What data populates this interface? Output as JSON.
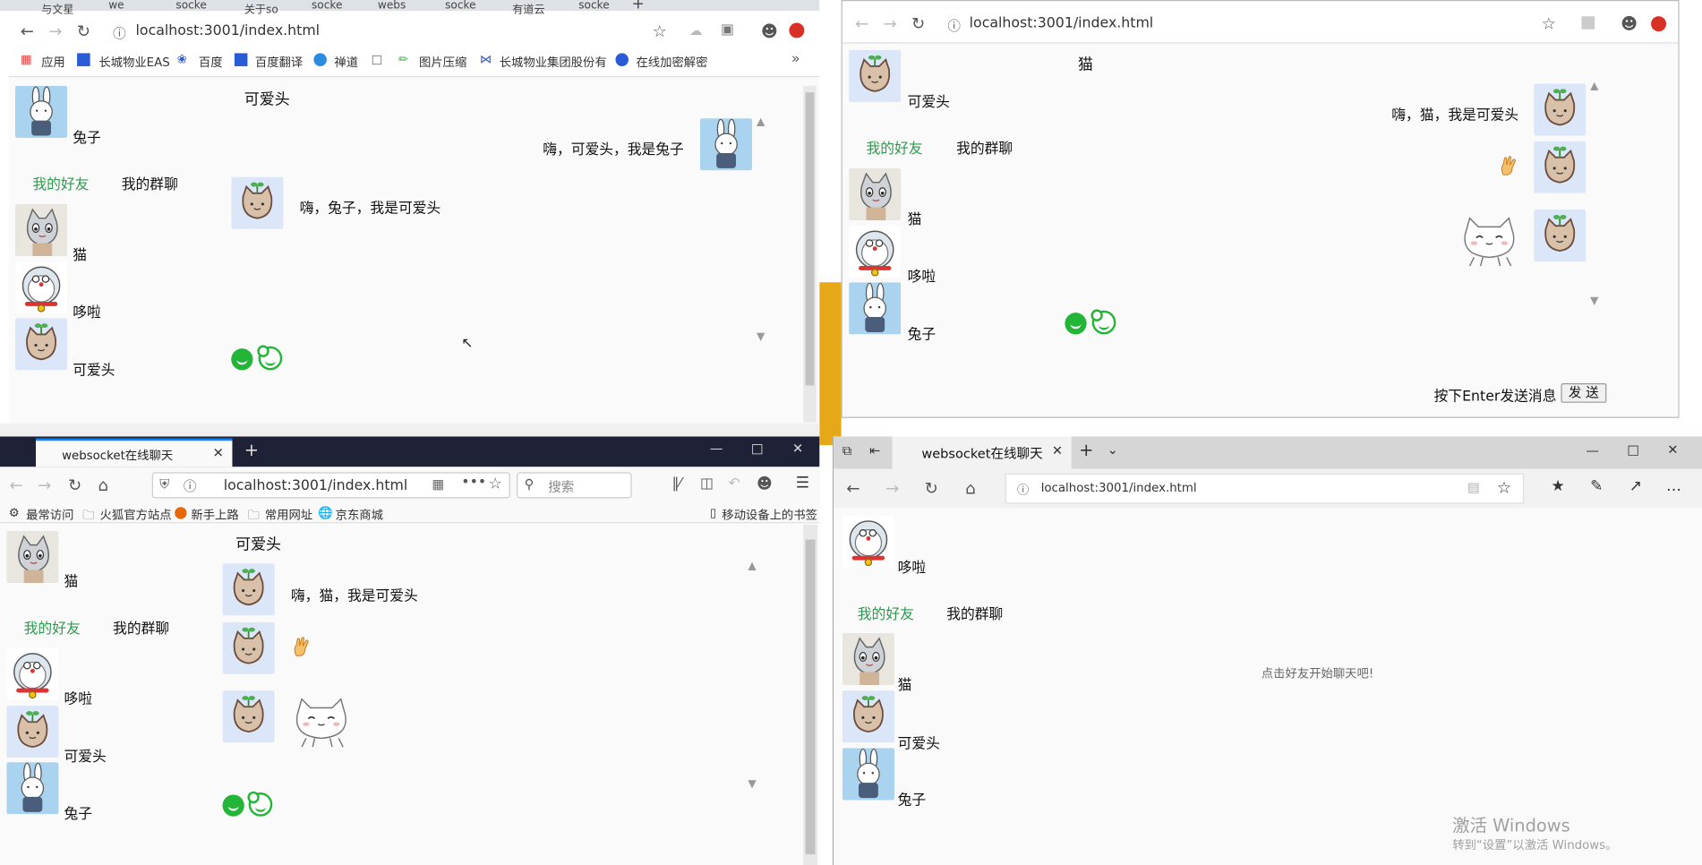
{
  "common": {
    "url": "localhost:3001/index.html",
    "friends_tab": "我的好友",
    "groups_tab": "我的群聊",
    "send_hint": "按下Enter发送消息",
    "send_button": "发 送",
    "empty_hint": "点击好友开始聊天吧!"
  },
  "names": {
    "cat": "猫",
    "doraemon": "哆啦",
    "rabbit": "兔子",
    "cute": "可爱头"
  },
  "win1": {
    "tabs": [
      "与文星",
      "we",
      "socke",
      "关于so",
      "socke",
      "webs",
      "socke",
      "有道云",
      "socke"
    ],
    "bookmarks": [
      "应用",
      "长城物业EAS",
      "百度",
      "百度翻译",
      "禅道",
      "图片压缩",
      "长城物业集团股份有",
      "在线加密解密"
    ],
    "current_user": "兔子",
    "chat_title": "可爱头",
    "msg_from_me": "嗨，可爱头，我是兔子",
    "msg_from_friend": "嗨，兔子，我是可爱头"
  },
  "win2": {
    "current_user": "可爱头",
    "chat_title": "猫",
    "msg_from_me": "嗨，猫，我是可爱头"
  },
  "win3": {
    "tab_title": "websocket在线聊天",
    "search_placeholder": "搜索",
    "bookmarks": [
      "最常访问",
      "火狐官方站点",
      "新手上路",
      "常用网址",
      "京东商城"
    ],
    "mobile_bookmarks": "移动设备上的书签",
    "current_user": "猫",
    "chat_title": "可爱头",
    "msg": "嗨，猫，我是可爱头"
  },
  "win4": {
    "tab_title": "websocket在线聊天",
    "current_user": "哆啦"
  },
  "watermark": {
    "line1": "激活 Windows",
    "line2": "转到“设置”以激活 Windows。"
  },
  "colors": {
    "accent_green": "#2e9a4e",
    "emoji_green": "#22b537",
    "firefox_dark": "#1f2236",
    "edge_gray": "#d6d6d6"
  }
}
